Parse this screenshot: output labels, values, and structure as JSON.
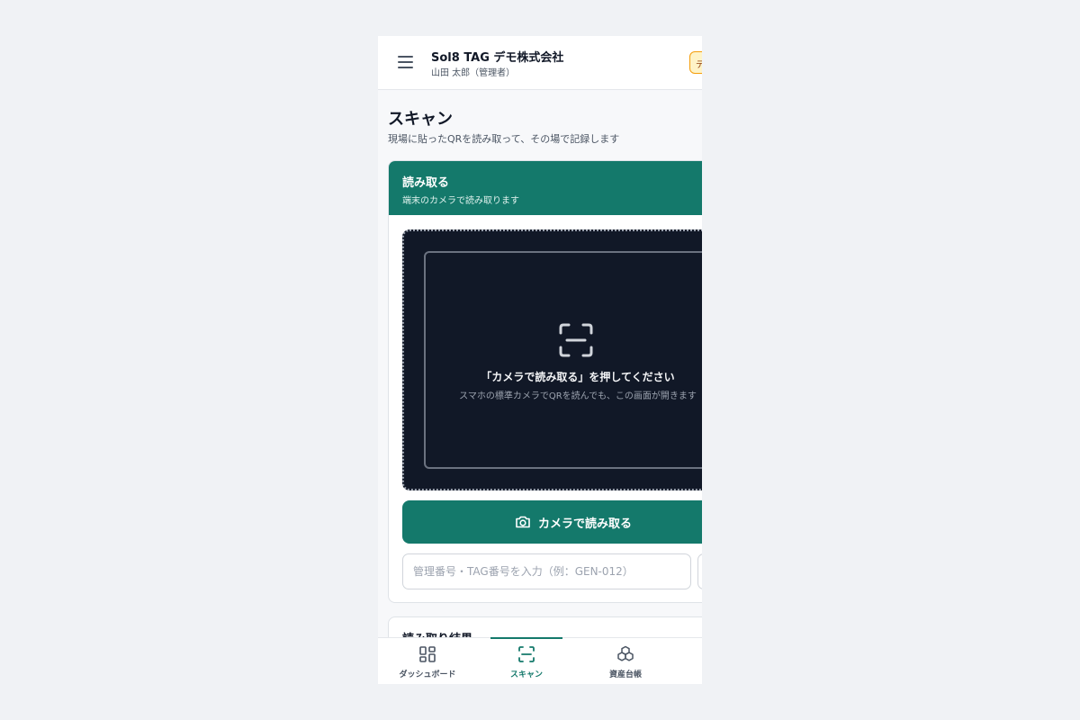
{
  "header": {
    "org_name": "Sol8 TAG デモ株式会社",
    "user_name": "山田 太郎（管理者）",
    "badge": "デモ"
  },
  "page": {
    "title": "スキャン",
    "subtitle": "現場に貼ったQRを読み取って、その場で記録します"
  },
  "scan_card": {
    "title": "読み取る",
    "subtitle": "端末のカメラで読み取ります",
    "viewer_main": "「カメラで読み取る」を押してください",
    "viewer_hint": "スマホの標準カメラでQRを読んでも、この画面が開きます",
    "camera_button": "カメラで読み取る",
    "input_placeholder": "管理番号・TAG番号を入力（例：GEN-012）"
  },
  "result_card": {
    "title": "読み取り結果"
  },
  "bottom_nav": {
    "items": [
      {
        "label": "ダッシュボード",
        "icon": "dashboard-icon"
      },
      {
        "label": "スキャン",
        "icon": "scan-icon"
      },
      {
        "label": "資産台帳",
        "icon": "cubes-icon"
      }
    ],
    "active_index": 1
  },
  "colors": {
    "primary": "#14796b",
    "viewer_bg": "#111827",
    "badge_bg": "#fef3c7",
    "badge_border": "#f59e0b"
  }
}
